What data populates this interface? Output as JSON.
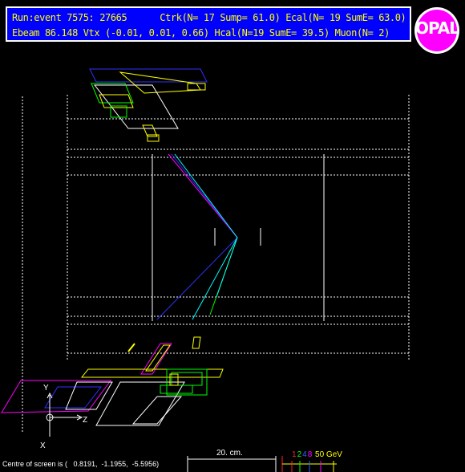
{
  "header": {
    "line1": "Run:event 7575: 27665      Ctrk(N= 17 Sump= 61.0) Ecal(N= 19 SumE= 63.0)",
    "line2": "Ebeam 86.148 Vtx (-0.01, 0.01, 0.66) Hcal(N=19 SumE= 39.5) Muon(N= 2)"
  },
  "logo": {
    "text": "OPAL"
  },
  "axes": {
    "y": "Y",
    "z": "Z",
    "x": "X"
  },
  "footer": {
    "centre_text": "Centre of screen is (   0.8191,  -1.1955,  -5.5956)",
    "scale_label": "20. cm.",
    "energy_legend": [
      {
        "text": "1",
        "color": "#ff2020"
      },
      {
        "text": "2",
        "color": "#00ff00"
      },
      {
        "text": "4",
        "color": "#3060ff"
      },
      {
        "text": "8",
        "color": "#ff00ff"
      },
      {
        "text": " 50 GeV",
        "color": "#ffff00"
      }
    ]
  },
  "colors": {
    "background": "#000000",
    "header_bg": "#0000ff",
    "header_text": "#ffff00",
    "track_magenta": "#ff00ff",
    "track_cyan": "#00ffff",
    "track_green": "#00ff00",
    "track_blue": "#3030ff"
  }
}
